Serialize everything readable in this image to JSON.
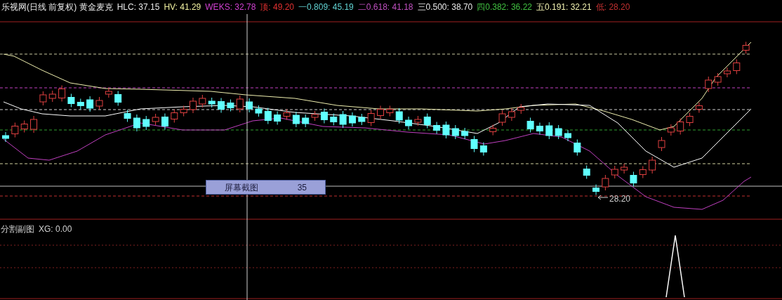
{
  "header": {
    "title": "乐视网(日线 前复权) 黄金麦克",
    "indicators": [
      {
        "text": "HLC: 37.15",
        "color": "#e8e8e8"
      },
      {
        "text": "HV: 41.29",
        "color": "#f0f0a0"
      },
      {
        "text": "WEKS: 32.78",
        "color": "#d040d0"
      },
      {
        "text": "顶: 49.20",
        "color": "#e03030"
      },
      {
        "text": "一0.809: 45.19",
        "color": "#60d0d0"
      },
      {
        "text": "二0.618: 41.18",
        "color": "#c050c0"
      },
      {
        "text": "三0.500: 38.70",
        "color": "#e8e8e8"
      },
      {
        "text": "四0.382: 36.22",
        "color": "#40c040"
      },
      {
        "text": "五0.191: 32.21",
        "color": "#f0f0b0"
      },
      {
        "text": "低: 28.20",
        "color": "#c03030"
      }
    ]
  },
  "tooltip": {
    "label": "屏幕截图",
    "value": "35"
  },
  "low_marker": {
    "label": "28.20"
  },
  "sub_chart": {
    "title": "分割副图",
    "indicator": "XG: 0.00"
  }
}
